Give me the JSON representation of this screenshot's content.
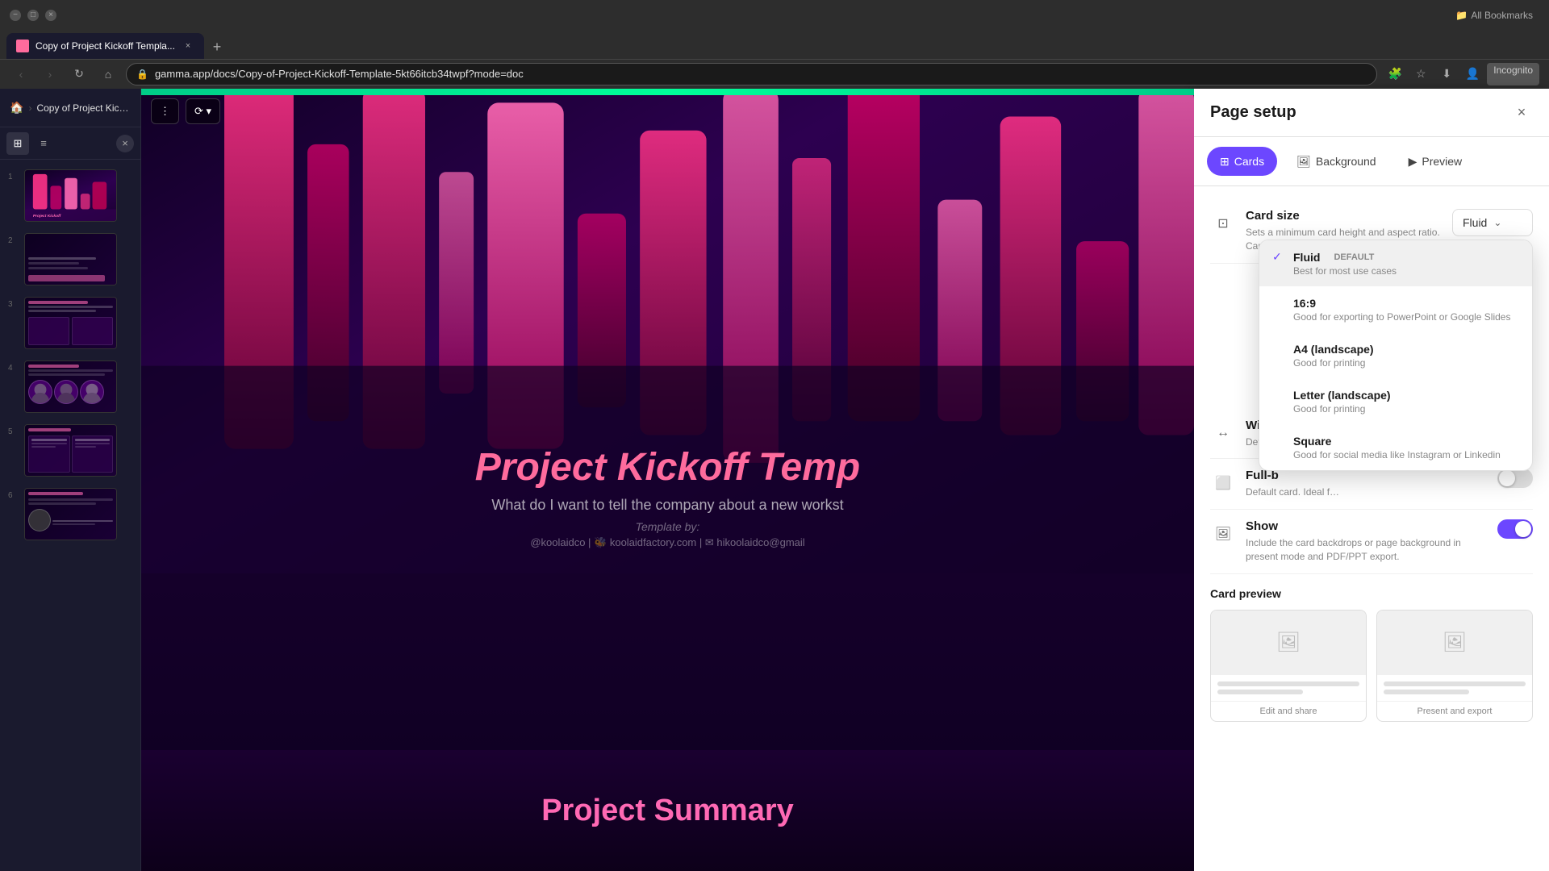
{
  "browser": {
    "tab": {
      "favicon_color": "#ff6b9d",
      "title": "Copy of Project Kickoff Templa...",
      "close_icon": "×"
    },
    "new_tab_icon": "+",
    "address": "gamma.app/docs/Copy-of-Project-Kickoff-Template-5kt66itcb34twpf?mode=doc",
    "nav": {
      "back": "‹",
      "forward": "›",
      "reload": "↻",
      "home": "⌂"
    },
    "actions": {
      "extensions": "🧩",
      "star": "☆",
      "download": "⬇",
      "profile": "👤",
      "incognito": "Incognito"
    },
    "bookmarks_label": "All Bookmarks"
  },
  "app": {
    "breadcrumb": {
      "home_icon": "🏠",
      "separator": "›",
      "title": "Copy of Project Kickoff Template"
    },
    "sidebar_tools": {
      "grid_icon": "⊞",
      "list_icon": "≡",
      "close_icon": "×"
    },
    "slides": [
      {
        "number": "1",
        "type": "hero"
      },
      {
        "number": "2",
        "type": "content"
      },
      {
        "number": "3",
        "type": "content"
      },
      {
        "number": "4",
        "type": "content"
      },
      {
        "number": "5",
        "type": "content"
      },
      {
        "number": "6",
        "type": "content"
      }
    ],
    "slide_title": "Project Kickoff Temp",
    "slide_subtitle": "What do I want to tell the company about a new workst",
    "slide_template_by": "Template by:",
    "slide_credits": "@koolaidco | 🐝 koolaidfactory.com | ✉ hikoolaidco@gmail",
    "slide2_title": "Project Summary",
    "content_toolbar": {
      "menu_icon": "⋮",
      "view_icon": "⟳"
    }
  },
  "panel": {
    "title": "Page setup",
    "close_icon": "×",
    "tabs": [
      {
        "id": "cards",
        "label": "Cards",
        "icon": "⊞",
        "active": true
      },
      {
        "id": "background",
        "label": "Background",
        "icon": "🖼",
        "active": false
      },
      {
        "id": "preview",
        "label": "Preview",
        "icon": "▶",
        "active": false
      }
    ],
    "card_size": {
      "label": "Card size",
      "description": "Sets a minimum card height and aspect ratio. Card content guides…",
      "icon": "⊡",
      "current_value": "Fluid",
      "dropdown_icon": "⌄"
    },
    "card_size_options": [
      {
        "id": "fluid",
        "name": "Fluid",
        "badge": "DEFAULT",
        "description": "Best for most use cases",
        "selected": true
      },
      {
        "id": "16-9",
        "name": "16:9",
        "badge": "",
        "description": "Good for exporting to PowerPoint or Google Slides",
        "selected": false
      },
      {
        "id": "a4",
        "name": "A4 (landscape)",
        "badge": "",
        "description": "Good for printing",
        "selected": false
      },
      {
        "id": "letter",
        "name": "Letter (landscape)",
        "badge": "",
        "description": "Good for printing",
        "selected": false
      },
      {
        "id": "square",
        "name": "Square",
        "badge": "",
        "description": "Good for social media like Instagram or Linkedin",
        "selected": false
      }
    ],
    "wide_mode": {
      "label": "Wide",
      "description": "Default card width that preserves…",
      "icon": "↔"
    },
    "full_bleed": {
      "label": "Full-b",
      "description": "Default card. Ideal f…",
      "icon": "⬜"
    },
    "show_backgrounds": {
      "label": "Show",
      "description": "Include the card backdrops or page background in present mode and PDF/PPT export.",
      "icon": "🖼",
      "toggle_on": true
    },
    "card_preview": {
      "label": "Card preview",
      "edit_label": "Edit and share",
      "export_label": "Present and export"
    }
  }
}
